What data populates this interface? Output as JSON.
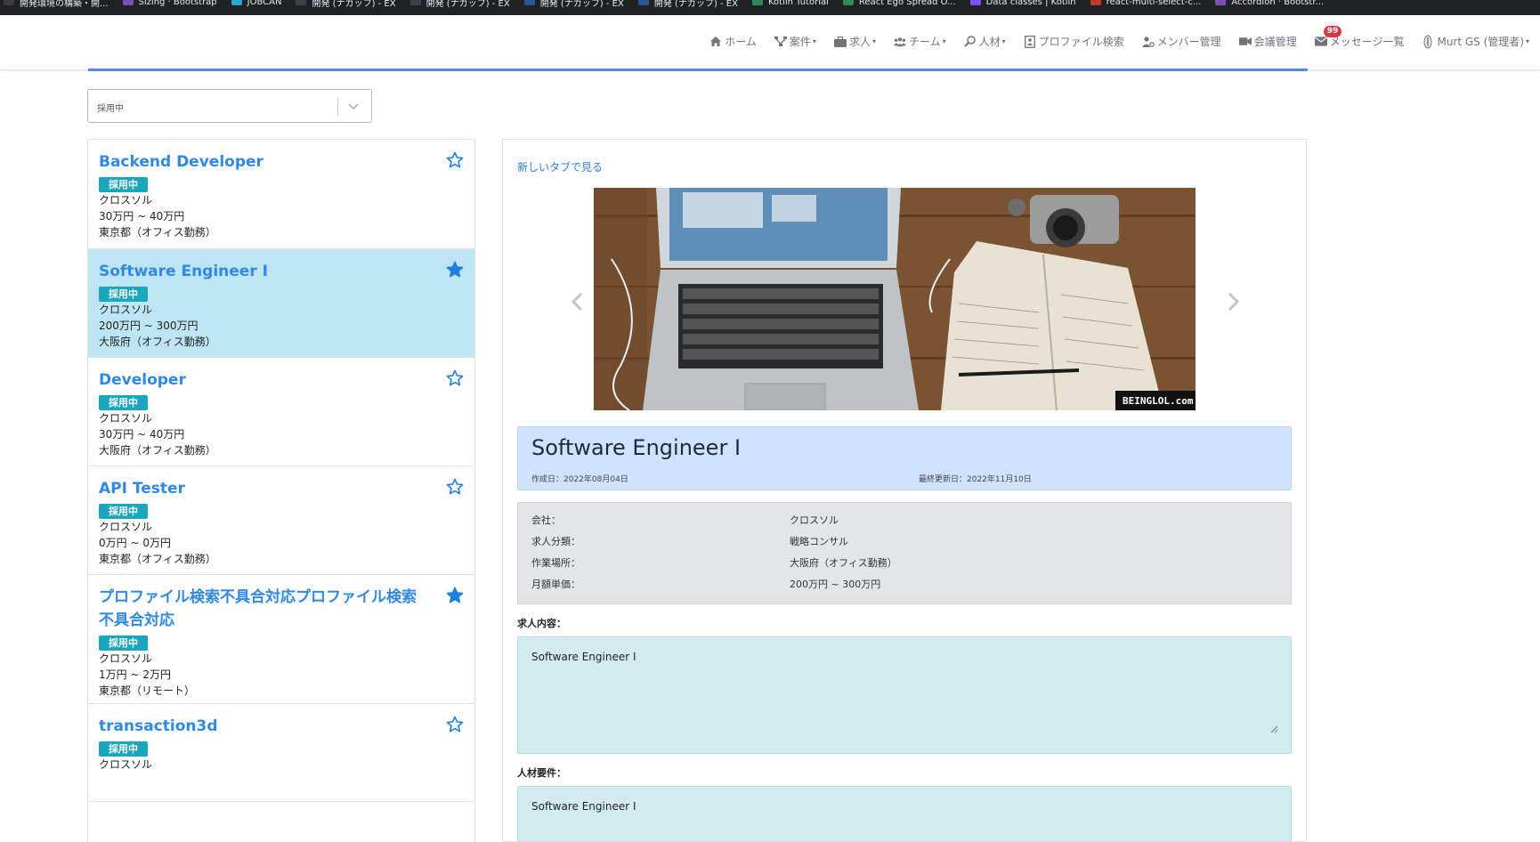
{
  "bookmarks": [
    {
      "label": "開発環境の構築・開...",
      "color": "#3b3b3b"
    },
    {
      "label": "Sizing · Bootstrap",
      "color": "#7952b3"
    },
    {
      "label": "JOBCAN",
      "color": "#29a3d8"
    },
    {
      "label": "開発 (ナガッフ) - EX",
      "color": "#39424e"
    },
    {
      "label": "開発 (ナガッフ) - EX",
      "color": "#39424e"
    },
    {
      "label": "開発 (ナガッフ) - EX",
      "color": "#2b5797"
    },
    {
      "label": "開発 (ナガッフ) - EX",
      "color": "#2b5797"
    },
    {
      "label": "Kotlin Tutorial",
      "color": "#2e8b57"
    },
    {
      "label": "React Ego Spread O...",
      "color": "#2e8b57"
    },
    {
      "label": "Data classes | Kotlin",
      "color": "#7f52ff"
    },
    {
      "label": "react-multi-select-c...",
      "color": "#c0392b"
    },
    {
      "label": "Accordion · Bootstr...",
      "color": "#7952b3"
    }
  ],
  "nav": {
    "home": "ホーム",
    "projects": "案件",
    "jobs": "求人",
    "teams": "チーム",
    "talent": "人材",
    "profile_search": "プロファイル検索",
    "member_mgmt": "メンバー管理",
    "meeting_mgmt": "会議管理",
    "messages": "メッセージ一覧",
    "messages_badge": "99",
    "user": "Murt GS (管理者)"
  },
  "status_filter": {
    "value": "採用中"
  },
  "jobs": [
    {
      "title": "Backend Developer",
      "status": "採用中",
      "company": "クロスソル",
      "salary": "30万円 ~ 40万円",
      "location": "東京都（オフィス勤務）",
      "favorite": false,
      "selected": false
    },
    {
      "title": "Software Engineer I",
      "status": "採用中",
      "company": "クロスソル",
      "salary": "200万円 ~ 300万円",
      "location": "大阪府（オフィス勤務）",
      "favorite": true,
      "selected": true
    },
    {
      "title": "Developer",
      "status": "採用中",
      "company": "クロスソル",
      "salary": "30万円 ~ 40万円",
      "location": "大阪府（オフィス勤務）",
      "favorite": false,
      "selected": false
    },
    {
      "title": "API Tester",
      "status": "採用中",
      "company": "クロスソル",
      "salary": "0万円 ~ 0万円",
      "location": "東京都（オフィス勤務）",
      "favorite": false,
      "selected": false
    },
    {
      "title": "プロファイル検索不具合対応プロファイル検索不具合対応",
      "status": "採用中",
      "company": "クロスソル",
      "salary": "1万円 ~ 2万円",
      "location": "東京都（リモート）",
      "favorite": true,
      "selected": false
    },
    {
      "title": "transaction3d",
      "status": "採用中",
      "company": "クロスソル",
      "salary": "",
      "location": "",
      "favorite": false,
      "selected": false
    }
  ],
  "detail": {
    "new_tab_link": "新しいタブで見る",
    "image_watermark": "BEINGLOL.com",
    "title": "Software Engineer I",
    "created": "作成日：2022年08月04日",
    "updated": "最終更新日：2022年11月10日",
    "info": [
      {
        "key": "会社：",
        "value": "クロスソル"
      },
      {
        "key": "求人分類：",
        "value": "戦略コンサル"
      },
      {
        "key": "作業場所：",
        "value": "大阪府（オフィス勤務）"
      },
      {
        "key": "月額単価：",
        "value": "200万円 ~ 300万円"
      }
    ],
    "job_content_label": "求人内容：",
    "job_content": "Software Engineer I",
    "requirements_label": "人材要件：",
    "requirements": "Software Engineer I"
  },
  "colors": {
    "link_blue": "#2f89e5",
    "status_badge": "#1aa6bd",
    "selected_bg": "#bee5f3",
    "title_box": "#cfe2ff",
    "textarea_bg": "#d1ebef"
  }
}
